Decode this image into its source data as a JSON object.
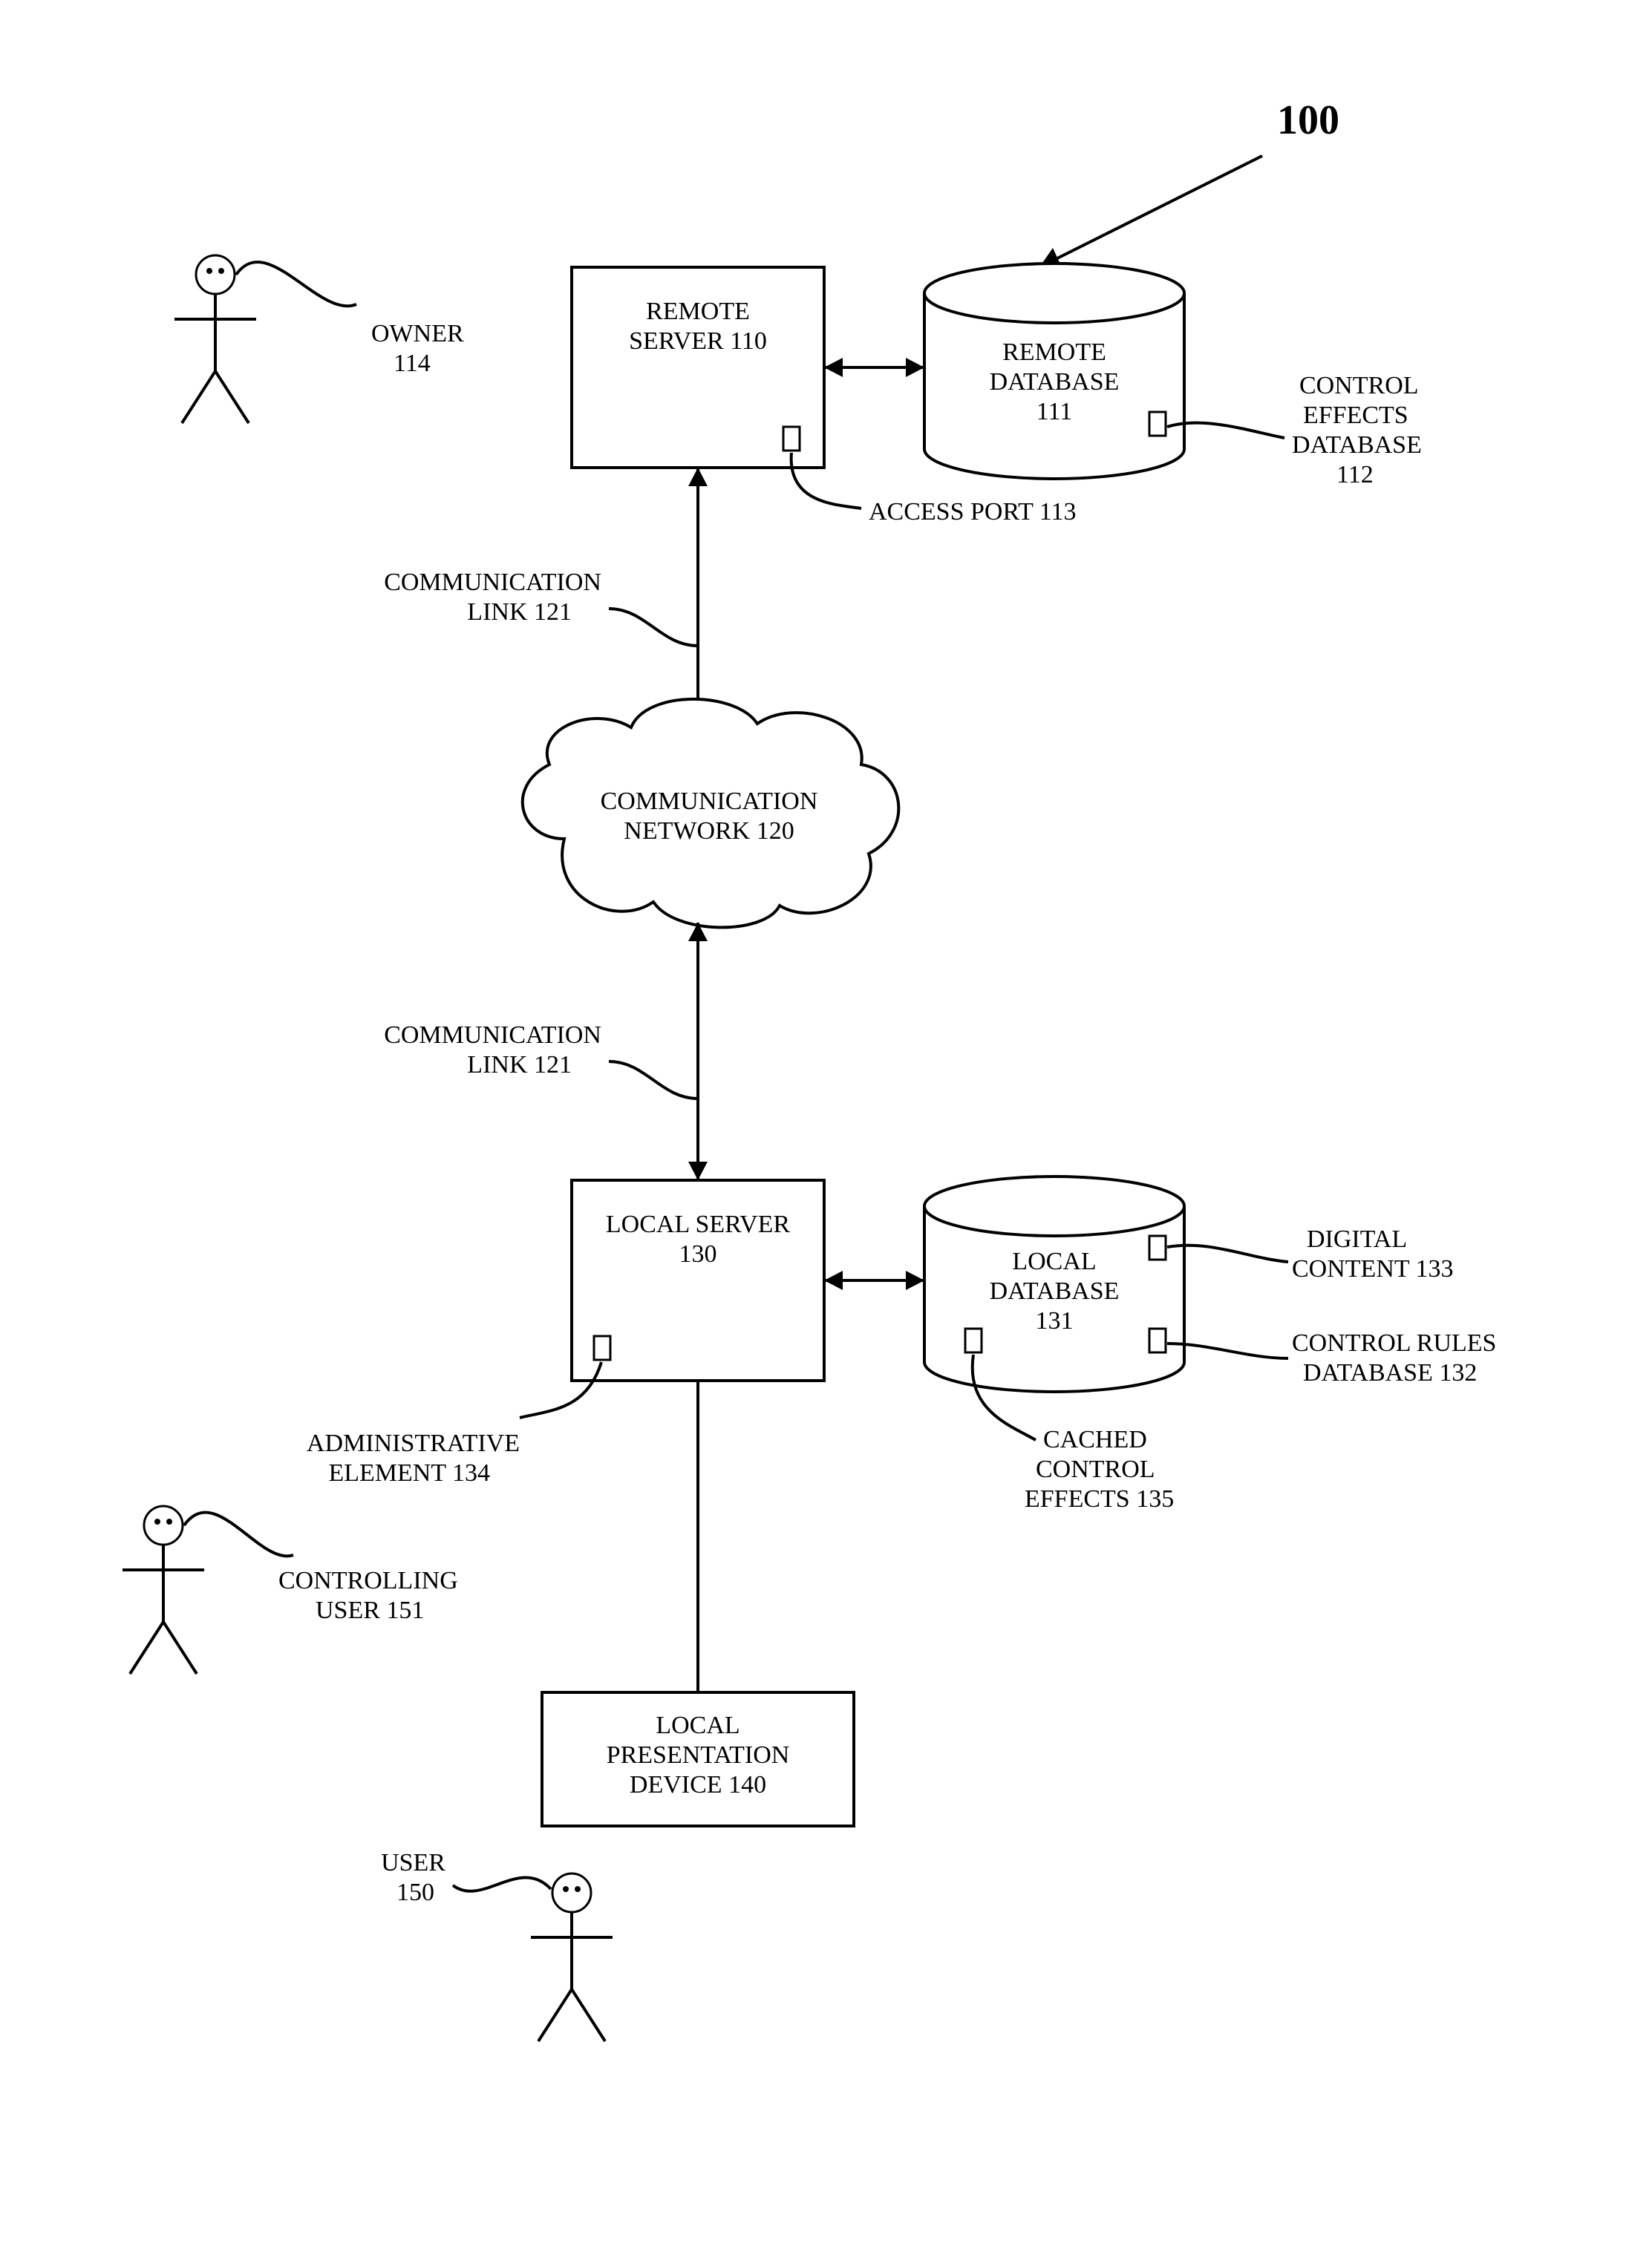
{
  "figure_ref": "100",
  "remote_server": {
    "line1": "REMOTE",
    "line2": "SERVER 110"
  },
  "remote_database": {
    "line1": "REMOTE",
    "line2": "DATABASE",
    "line3": "111"
  },
  "access_port": "ACCESS PORT 113",
  "control_effects_db": {
    "line1": "CONTROL",
    "line2": "EFFECTS",
    "line3": "DATABASE",
    "line4": "112"
  },
  "owner": {
    "line1": "OWNER",
    "line2": "114"
  },
  "comm_link_upper": {
    "line1": "COMMUNICATION",
    "line2": "LINK 121"
  },
  "comm_network": {
    "line1": "COMMUNICATION",
    "line2": "NETWORK 120"
  },
  "comm_link_lower": {
    "line1": "COMMUNICATION",
    "line2": "LINK 121"
  },
  "local_server": {
    "line1": "LOCAL SERVER",
    "line2": "130"
  },
  "local_database": {
    "line1": "LOCAL",
    "line2": "DATABASE",
    "line3": "131"
  },
  "digital_content": {
    "line1": "DIGITAL",
    "line2": "CONTENT 133"
  },
  "control_rules_db": {
    "line1": "CONTROL RULES",
    "line2": "DATABASE 132"
  },
  "cached_control_effects": {
    "line1": "CACHED",
    "line2": "CONTROL",
    "line3": "EFFECTS 135"
  },
  "admin_element": {
    "line1": "ADMINISTRATIVE",
    "line2": "ELEMENT 134"
  },
  "controlling_user": {
    "line1": "CONTROLLING",
    "line2": "USER 151"
  },
  "local_presentation": {
    "line1": "LOCAL",
    "line2": "PRESENTATION",
    "line3": "DEVICE 140"
  },
  "user": {
    "line1": "USER",
    "line2": "150"
  }
}
